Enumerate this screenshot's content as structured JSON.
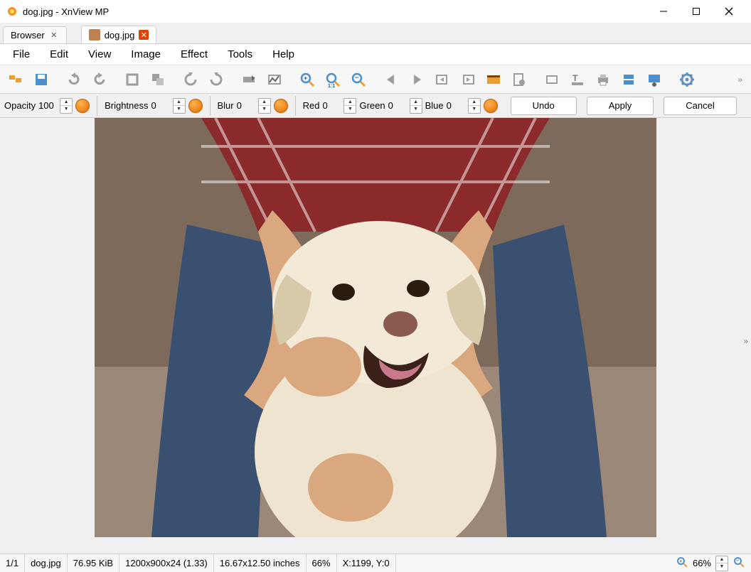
{
  "window": {
    "title": "dog.jpg - XnView MP"
  },
  "tabs": {
    "browser": "Browser",
    "file": "dog.jpg"
  },
  "menu": {
    "file": "File",
    "edit": "Edit",
    "view": "View",
    "image": "Image",
    "effect": "Effect",
    "tools": "Tools",
    "help": "Help"
  },
  "toolbar_icons": [
    "browser-icon",
    "save-icon",
    "undo-icon",
    "redo-icon",
    "crop-icon",
    "resize-icon",
    "rotate-left-icon",
    "rotate-right-icon",
    "adjust-icon",
    "levels-icon",
    "zoom-in-icon",
    "zoom-100-icon",
    "zoom-out-icon",
    "prev-file-icon",
    "next-file-icon",
    "first-icon",
    "last-icon",
    "slideshow-icon",
    "tag-icon",
    "fullscreen-icon",
    "text-icon",
    "print-icon",
    "convert-icon",
    "capture-icon",
    "settings-icon"
  ],
  "adjust": {
    "opacity": {
      "label": "Opacity",
      "value": "100"
    },
    "brightness": {
      "label": "Brightness",
      "value": "0"
    },
    "blur": {
      "label": "Blur",
      "value": "0"
    },
    "red": {
      "label": "Red",
      "value": "0"
    },
    "green": {
      "label": "Green",
      "value": "0"
    },
    "blue": {
      "label": "Blue",
      "value": "0"
    },
    "undo": "Undo",
    "apply": "Apply",
    "cancel": "Cancel"
  },
  "status": {
    "index": "1/1",
    "filename": "dog.jpg",
    "filesize": "76.95 KiB",
    "dimensions": "1200x900x24 (1.33)",
    "physical": "16.67x12.50 inches",
    "zoom": "66%",
    "cursor": "X:1199, Y:0",
    "zoom_control": "66%"
  }
}
